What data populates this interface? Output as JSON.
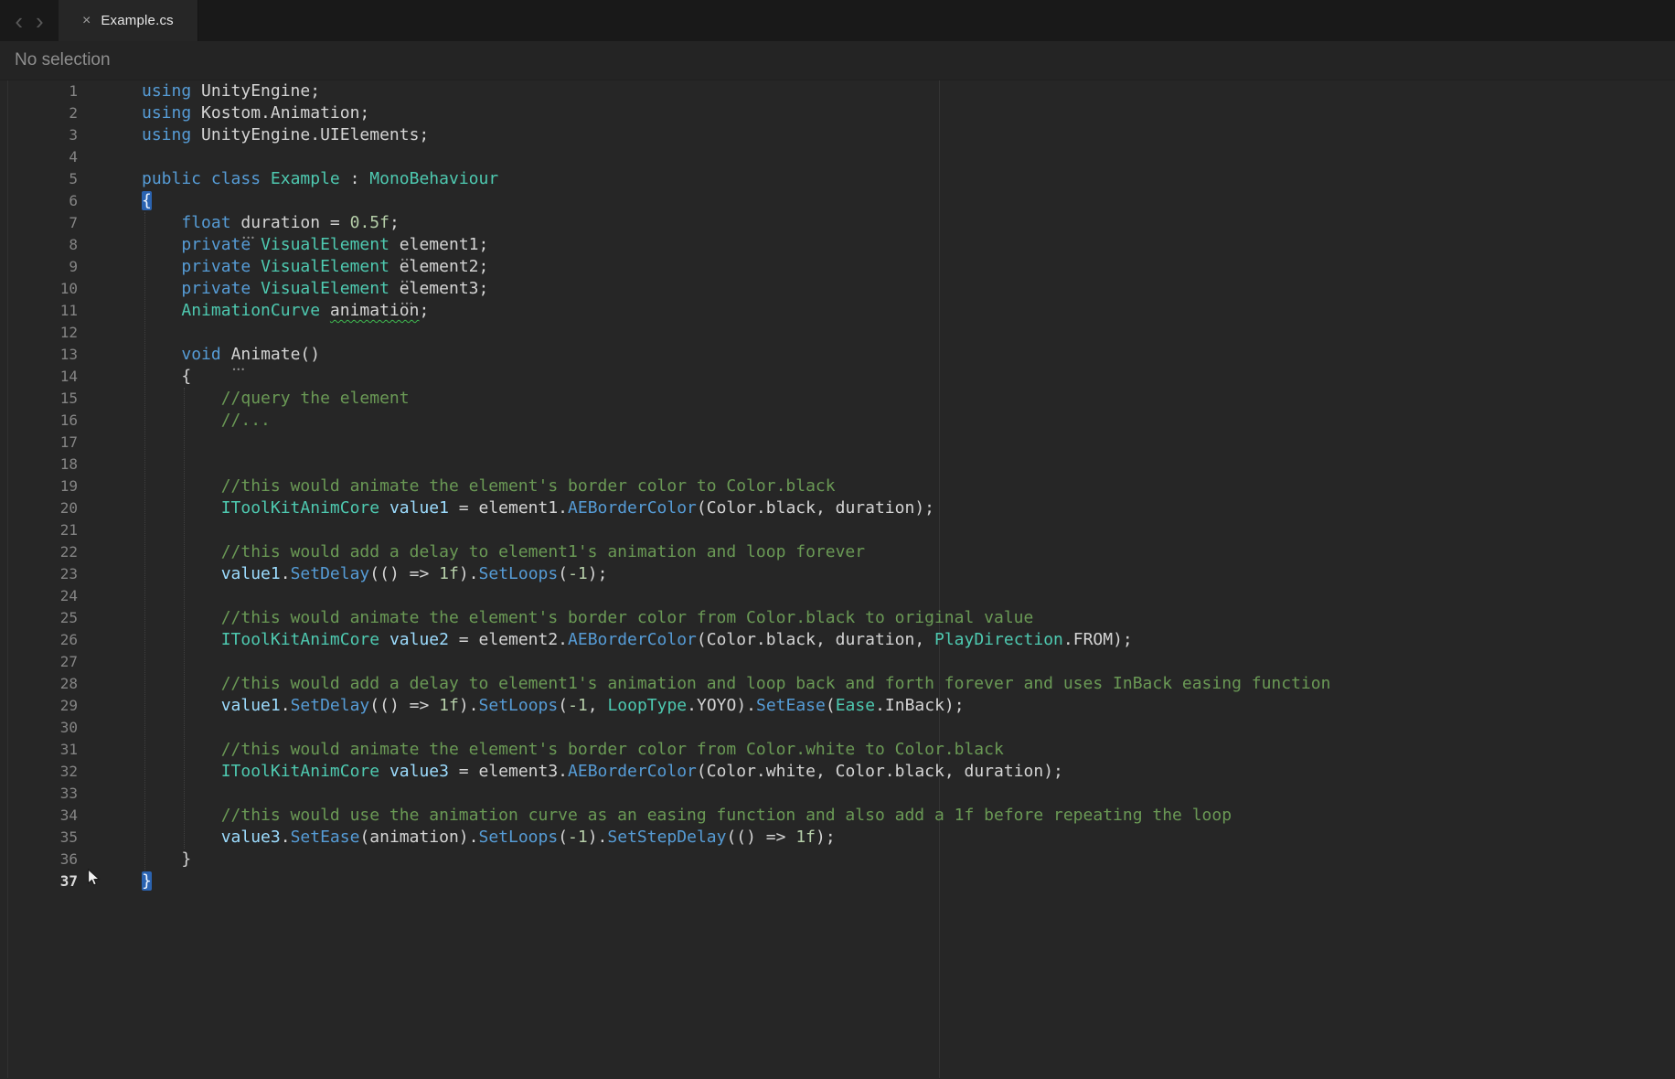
{
  "tab_bar": {
    "back_icon": "‹",
    "forward_icon": "›",
    "tab": {
      "close_icon": "×",
      "title": "Example.cs"
    }
  },
  "inspector": {
    "status": "No selection"
  },
  "colors": {
    "editor_bg": "#262626",
    "tab_bar_bg": "#191919",
    "keyword": "#569cd6",
    "type": "#4ec9b0",
    "variable": "#9cdcfe",
    "method": "#569cd6",
    "number": "#b5cea8",
    "comment": "#6a9955",
    "text": "#d4d4d4",
    "line_number": "#858585",
    "brace_highlight_bg": "#2b63b0",
    "squiggle": "#3fb950"
  },
  "editor": {
    "active_line": 37,
    "lines": [
      {
        "n": 1,
        "t": [
          [
            "using",
            "kw"
          ],
          [
            " UnityEngine;",
            "pl"
          ]
        ]
      },
      {
        "n": 2,
        "t": [
          [
            "using",
            "kw"
          ],
          [
            " Kostom.Animation;",
            "pl"
          ]
        ]
      },
      {
        "n": 3,
        "t": [
          [
            "using",
            "kw"
          ],
          [
            " UnityEngine.UIElements;",
            "pl"
          ]
        ]
      },
      {
        "n": 4,
        "t": []
      },
      {
        "n": 5,
        "t": [
          [
            "public",
            "kw"
          ],
          [
            " ",
            "pl"
          ],
          [
            "class",
            "kw"
          ],
          [
            " ",
            "pl"
          ],
          [
            "Example",
            "ty"
          ],
          [
            " : ",
            "pl"
          ],
          [
            "MonoBehaviour",
            "ty"
          ]
        ]
      },
      {
        "n": 6,
        "t": [
          [
            "{",
            "br"
          ]
        ]
      },
      {
        "n": 7,
        "t": [
          [
            "    ",
            "pl"
          ],
          [
            "float",
            "kw"
          ],
          [
            " ",
            "pl"
          ],
          [
            "duration",
            "pl dots"
          ],
          [
            " = ",
            "pl"
          ],
          [
            "0.5f",
            "nm"
          ],
          [
            ";",
            "pl"
          ]
        ]
      },
      {
        "n": 8,
        "t": [
          [
            "    ",
            "pl"
          ],
          [
            "private",
            "kw"
          ],
          [
            " ",
            "pl"
          ],
          [
            "VisualElement",
            "ty"
          ],
          [
            " ",
            "pl"
          ],
          [
            "element1",
            "pl dots"
          ],
          [
            ";",
            "pl"
          ]
        ]
      },
      {
        "n": 9,
        "t": [
          [
            "    ",
            "pl"
          ],
          [
            "private",
            "kw"
          ],
          [
            " ",
            "pl"
          ],
          [
            "VisualElement",
            "ty"
          ],
          [
            " ",
            "pl"
          ],
          [
            "element2",
            "pl dots"
          ],
          [
            ";",
            "pl"
          ]
        ]
      },
      {
        "n": 10,
        "t": [
          [
            "    ",
            "pl"
          ],
          [
            "private",
            "kw"
          ],
          [
            " ",
            "pl"
          ],
          [
            "VisualElement",
            "ty"
          ],
          [
            " ",
            "pl"
          ],
          [
            "element3",
            "pl dots"
          ],
          [
            ";",
            "pl"
          ]
        ]
      },
      {
        "n": 11,
        "t": [
          [
            "    ",
            "pl"
          ],
          [
            "AnimationCurve",
            "ty"
          ],
          [
            " ",
            "pl"
          ],
          [
            "animation",
            "pl sq"
          ],
          [
            ";",
            "pl"
          ]
        ]
      },
      {
        "n": 12,
        "t": []
      },
      {
        "n": 13,
        "t": [
          [
            "    ",
            "pl"
          ],
          [
            "void",
            "kw"
          ],
          [
            " ",
            "pl"
          ],
          [
            "Animate",
            "pl dots"
          ],
          [
            "()",
            "pl"
          ]
        ]
      },
      {
        "n": 14,
        "t": [
          [
            "    {",
            "pl"
          ]
        ]
      },
      {
        "n": 15,
        "t": [
          [
            "        ",
            "pl"
          ],
          [
            "//query the element",
            "cm"
          ]
        ]
      },
      {
        "n": 16,
        "t": [
          [
            "        ",
            "pl"
          ],
          [
            "//...",
            "cm"
          ]
        ]
      },
      {
        "n": 17,
        "t": []
      },
      {
        "n": 18,
        "t": []
      },
      {
        "n": 19,
        "t": [
          [
            "        ",
            "pl"
          ],
          [
            "//this would animate the element's border color to Color.black",
            "cm"
          ]
        ]
      },
      {
        "n": 20,
        "t": [
          [
            "        ",
            "pl"
          ],
          [
            "IToolKitAnimCore",
            "ty"
          ],
          [
            " ",
            "pl"
          ],
          [
            "value1",
            "vr"
          ],
          [
            " = element1.",
            "pl"
          ],
          [
            "AEBorderColor",
            "mt"
          ],
          [
            "(Color.black, duration);",
            "pl"
          ]
        ]
      },
      {
        "n": 21,
        "t": []
      },
      {
        "n": 22,
        "t": [
          [
            "        ",
            "pl"
          ],
          [
            "//this would add a delay to element1's animation and loop forever",
            "cm"
          ]
        ]
      },
      {
        "n": 23,
        "t": [
          [
            "        ",
            "pl"
          ],
          [
            "value1",
            "vr"
          ],
          [
            ".",
            "pl"
          ],
          [
            "SetDelay",
            "mt"
          ],
          [
            "(() => ",
            "pl"
          ],
          [
            "1f",
            "nm"
          ],
          [
            ").",
            "pl"
          ],
          [
            "SetLoops",
            "mt"
          ],
          [
            "(",
            "pl"
          ],
          [
            "-1",
            "nm"
          ],
          [
            ");",
            "pl"
          ]
        ]
      },
      {
        "n": 24,
        "t": []
      },
      {
        "n": 25,
        "t": [
          [
            "        ",
            "pl"
          ],
          [
            "//this would animate the element's border color from Color.black to original value",
            "cm"
          ]
        ]
      },
      {
        "n": 26,
        "t": [
          [
            "        ",
            "pl"
          ],
          [
            "IToolKitAnimCore",
            "ty"
          ],
          [
            " ",
            "pl"
          ],
          [
            "value2",
            "vr"
          ],
          [
            " = element2.",
            "pl"
          ],
          [
            "AEBorderColor",
            "mt"
          ],
          [
            "(Color.black, duration, ",
            "pl"
          ],
          [
            "PlayDirection",
            "ty"
          ],
          [
            ".FROM);",
            "pl"
          ]
        ]
      },
      {
        "n": 27,
        "t": []
      },
      {
        "n": 28,
        "t": [
          [
            "        ",
            "pl"
          ],
          [
            "//this would add a delay to element1's animation and loop back and forth forever and uses InBack easing function",
            "cm"
          ]
        ]
      },
      {
        "n": 29,
        "t": [
          [
            "        ",
            "pl"
          ],
          [
            "value1",
            "vr"
          ],
          [
            ".",
            "pl"
          ],
          [
            "SetDelay",
            "mt"
          ],
          [
            "(() => ",
            "pl"
          ],
          [
            "1f",
            "nm"
          ],
          [
            ").",
            "pl"
          ],
          [
            "SetLoops",
            "mt"
          ],
          [
            "(",
            "pl"
          ],
          [
            "-1",
            "nm"
          ],
          [
            ", ",
            "pl"
          ],
          [
            "LoopType",
            "ty"
          ],
          [
            ".YOYO).",
            "pl"
          ],
          [
            "SetEase",
            "mt"
          ],
          [
            "(",
            "pl"
          ],
          [
            "Ease",
            "ty"
          ],
          [
            ".InBack);",
            "pl"
          ]
        ]
      },
      {
        "n": 30,
        "t": []
      },
      {
        "n": 31,
        "t": [
          [
            "        ",
            "pl"
          ],
          [
            "//this would animate the element's border color from Color.white to Color.black",
            "cm"
          ]
        ]
      },
      {
        "n": 32,
        "t": [
          [
            "        ",
            "pl"
          ],
          [
            "IToolKitAnimCore",
            "ty"
          ],
          [
            " ",
            "pl"
          ],
          [
            "value3",
            "vr"
          ],
          [
            " = element3.",
            "pl"
          ],
          [
            "AEBorderColor",
            "mt"
          ],
          [
            "(Color.white, Color.black, duration);",
            "pl"
          ]
        ]
      },
      {
        "n": 33,
        "t": []
      },
      {
        "n": 34,
        "t": [
          [
            "        ",
            "pl"
          ],
          [
            "//this would use the animation curve as an easing function and also add a 1f before repeating the loop",
            "cm"
          ]
        ]
      },
      {
        "n": 35,
        "t": [
          [
            "        ",
            "pl"
          ],
          [
            "value3",
            "vr"
          ],
          [
            ".",
            "pl"
          ],
          [
            "SetEase",
            "mt"
          ],
          [
            "(animation).",
            "pl"
          ],
          [
            "SetLoops",
            "mt"
          ],
          [
            "(",
            "pl"
          ],
          [
            "-1",
            "nm"
          ],
          [
            ").",
            "pl"
          ],
          [
            "SetStepDelay",
            "mt"
          ],
          [
            "(() => ",
            "pl"
          ],
          [
            "1f",
            "nm"
          ],
          [
            ");",
            "pl"
          ]
        ]
      },
      {
        "n": 36,
        "t": [
          [
            "    }",
            "pl"
          ]
        ]
      },
      {
        "n": 37,
        "t": [
          [
            "}",
            "br"
          ]
        ]
      }
    ]
  }
}
